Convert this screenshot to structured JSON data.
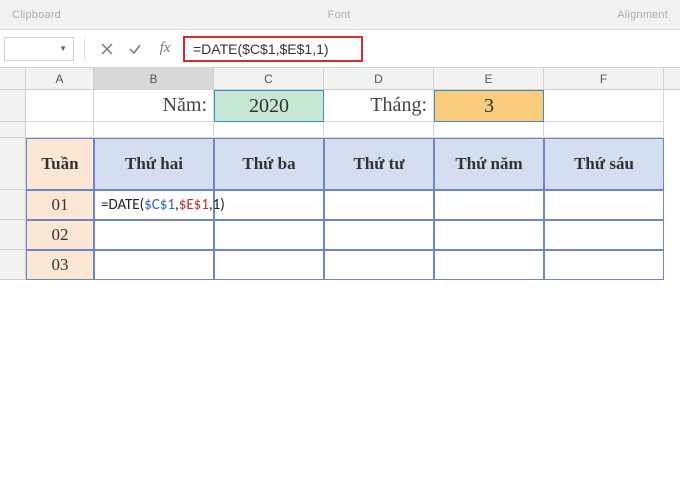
{
  "ribbon": {
    "group_left": "Clipboard",
    "group_mid": "Font",
    "group_right": "Alignment"
  },
  "formula_bar": {
    "name_box": "",
    "fx_label": "fx",
    "formula": "=DATE($C$1,$E$1,1)"
  },
  "columns": [
    "A",
    "B",
    "C",
    "D",
    "E",
    "F"
  ],
  "row1": {
    "year_label": "Năm:",
    "year_value": "2020",
    "month_label": "Tháng:",
    "month_value": "3"
  },
  "table": {
    "week_header": "Tuần",
    "dow": [
      "Thứ hai",
      "Thứ ba",
      "Thứ tư",
      "Thứ năm",
      "Thứ sáu"
    ],
    "weeks": [
      "01",
      "02",
      "03"
    ]
  },
  "editing": {
    "prefix": "=DATE(",
    "ref1": "$C$1",
    "comma1": ",",
    "ref2": "$E$1",
    "comma2": ",",
    "tail": "1)"
  },
  "chart_data": {
    "type": "table",
    "title": "Excel worksheet with DATE formula being entered",
    "formula_in_edit": "=DATE($C$1,$E$1,1)",
    "inputs": {
      "C1_year": 2020,
      "E1_month": 3
    },
    "columns": [
      "Tuần",
      "Thứ hai",
      "Thứ ba",
      "Thứ tư",
      "Thứ năm",
      "Thứ sáu"
    ],
    "rows": [
      {
        "Tuần": "01",
        "Thứ hai": "=DATE($C$1,$E$1,1)",
        "Thứ ba": "",
        "Thứ tư": "",
        "Thứ năm": "",
        "Thứ sáu": ""
      },
      {
        "Tuần": "02",
        "Thứ hai": "",
        "Thứ ba": "",
        "Thứ tư": "",
        "Thứ năm": "",
        "Thứ sáu": ""
      },
      {
        "Tuần": "03",
        "Thứ hai": "",
        "Thứ ba": "",
        "Thứ tư": "",
        "Thứ năm": "",
        "Thứ sáu": ""
      }
    ]
  }
}
